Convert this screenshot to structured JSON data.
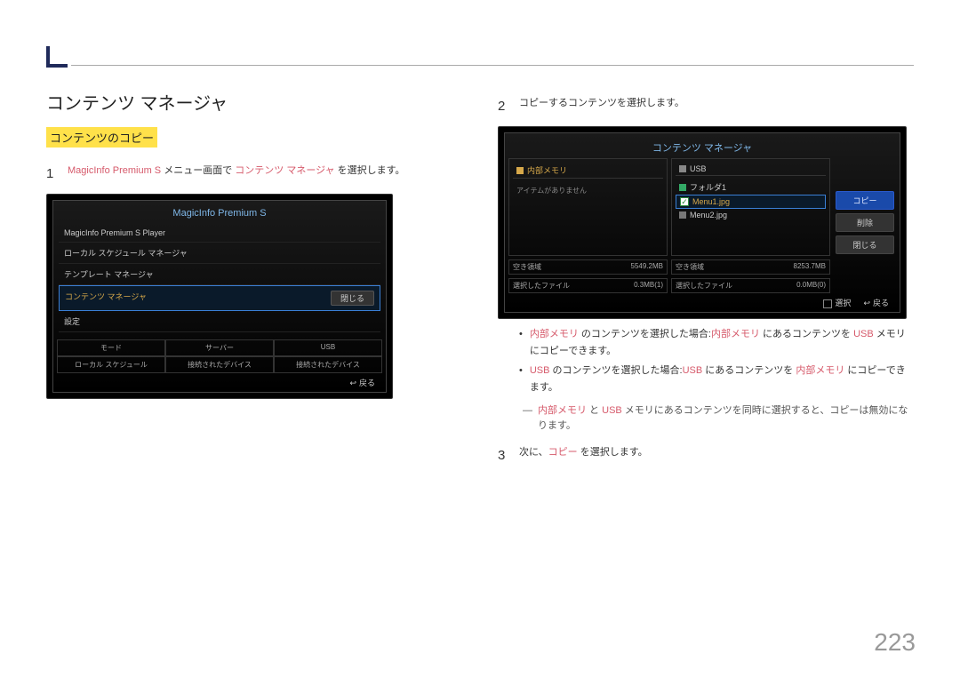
{
  "page_number": "223",
  "heading": "コンテンツ マネージャ",
  "subheading": "コンテンツのコピー",
  "step1": {
    "num": "1",
    "pre": "MagicInfo Premium S",
    "mid": " メニュー画面で ",
    "hl": "コンテンツ マネージャ",
    "post": " を選択します。"
  },
  "screen1": {
    "title": "MagicInfo Premium S",
    "rows": [
      "MagicInfo Premium S Player",
      "ローカル スケジュール マネージャ",
      "テンプレート マネージャ"
    ],
    "highlight_row": "コンテンツ マネージャ",
    "close_label": "閉じる",
    "row_after": "設定",
    "grid_top": [
      "モード",
      "サーバー",
      "USB"
    ],
    "grid_bottom": [
      "ローカル スケジュール",
      "接続されたデバイス",
      "接続されたデバイス"
    ],
    "return": "戻る"
  },
  "step2": {
    "num": "2",
    "text": "コピーするコンテンツを選択します。"
  },
  "screen2": {
    "title": "コンテンツ マネージャ",
    "left_tab": "内部メモリ",
    "right_tab": "USB",
    "empty": "アイテムがありません",
    "folder": "フォルダ1",
    "file_selected": "Menu1.jpg",
    "file2": "Menu2.jpg",
    "btn_copy": "コピー",
    "btn_delete": "削除",
    "btn_close": "閉じる",
    "info1_l": "空き領域",
    "info1_r": "5549.2MB",
    "info2_l": "空き領域",
    "info2_r": "8253.7MB",
    "info3_l": "選択したファイル",
    "info3_r": "0.3MB(1)",
    "info4_l": "選択したファイル",
    "info4_r": "0.0MB(0)",
    "select": "選択",
    "return": "戻る"
  },
  "bullets": {
    "b1a": "内部メモリ",
    "b1b": " のコンテンツを選択した場合:",
    "b1c": "内部メモリ",
    "b1d": " にあるコンテンツを ",
    "b1e": "USB",
    "b1f": " メモリにコピーできます。",
    "b2a": "USB",
    "b2b": " のコンテンツを選択した場合:",
    "b2c": "USB",
    "b2d": " にあるコンテンツを ",
    "b2e": "内部メモリ",
    "b2f": " にコピーできます。"
  },
  "dash": {
    "a": "内部メモリ",
    "b": " と ",
    "c": "USB",
    "d": " メモリにあるコンテンツを同時に選択すると、コピーは無効になります。"
  },
  "step3": {
    "num": "3",
    "pre": "次に、",
    "hl": "コピー",
    "post": " を選択します。"
  }
}
